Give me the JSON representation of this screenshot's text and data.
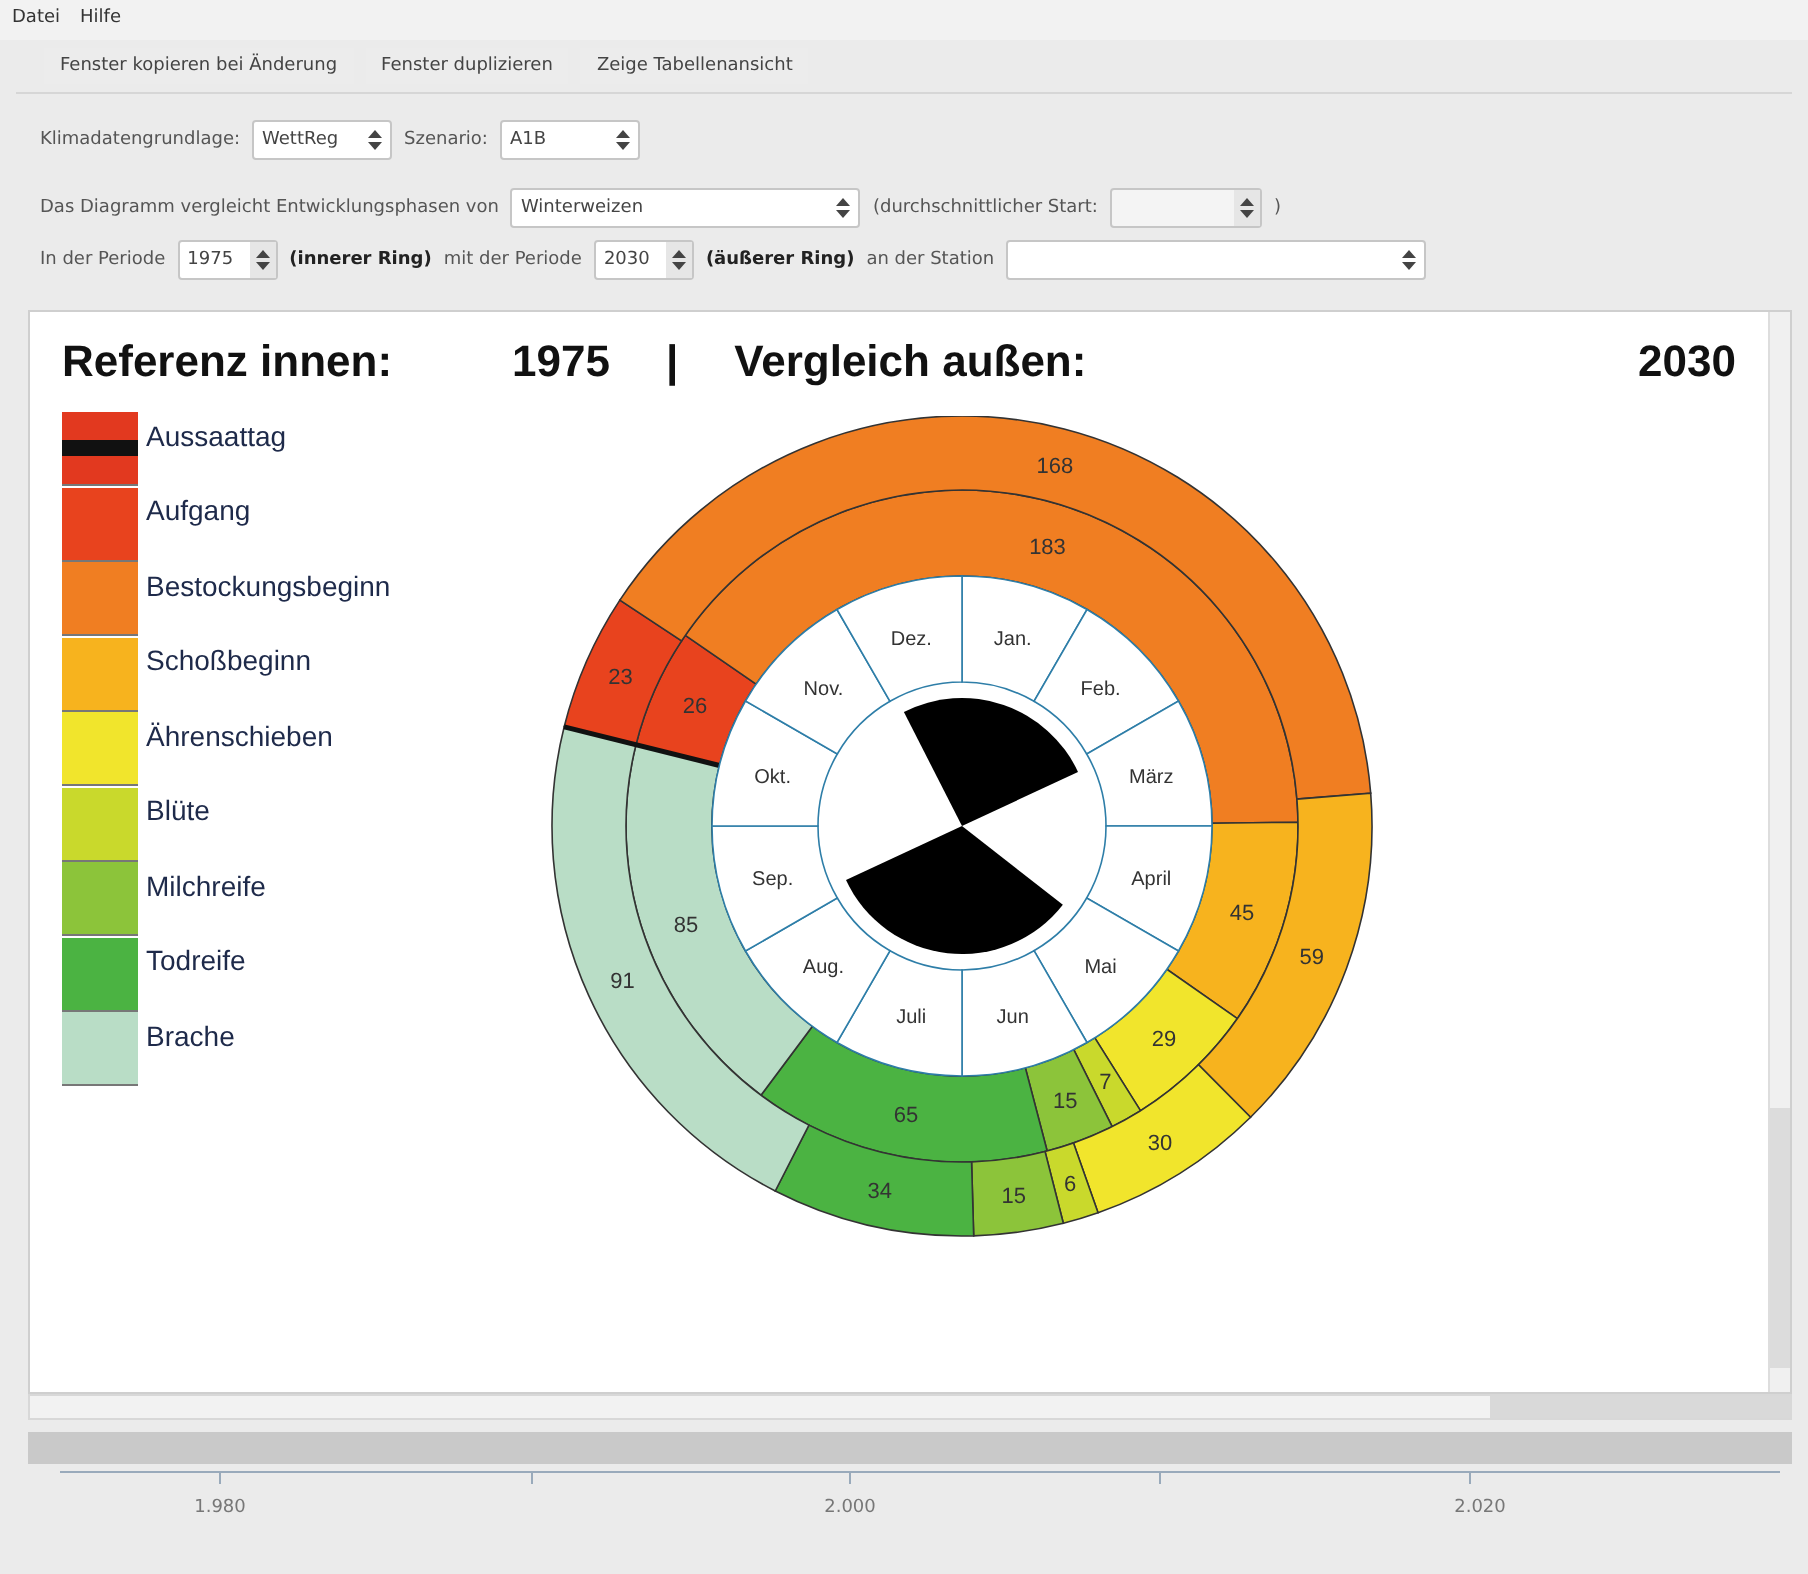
{
  "menu": [
    "Datei",
    "Hilfe"
  ],
  "toolbar": [
    "Fenster kopieren bei Änderung",
    "Fenster duplizieren",
    "Zeige Tabellenansicht"
  ],
  "form_rows": [
    [
      {
        "kind": "label",
        "text": "Klimadatengrundlage:"
      },
      {
        "kind": "select",
        "value": "WettReg"
      },
      {
        "kind": "label",
        "text": "Szenario:"
      },
      {
        "kind": "select",
        "value": "A1B"
      }
    ],
    [
      {
        "kind": "label",
        "text": "Das Diagramm vergleicht Entwicklungsphasen von"
      },
      {
        "kind": "select",
        "value": "Winterweizen"
      },
      {
        "kind": "label",
        "text": "(durchschnittlicher Start:"
      },
      {
        "kind": "spinner",
        "disabled": true
      },
      {
        "kind": "label",
        "text": ")"
      }
    ],
    [
      {
        "kind": "label",
        "text": "In der Periode"
      },
      {
        "kind": "spinner",
        "value": "1975"
      },
      {
        "kind": "bold",
        "text": "(innerer Ring)"
      },
      {
        "kind": "label",
        "text": "mit der Periode"
      },
      {
        "kind": "spinner",
        "value": "2030"
      },
      {
        "kind": "bold",
        "text": "(äußerer Ring)"
      },
      {
        "kind": "label",
        "text": "an der Station"
      },
      {
        "kind": "select"
      }
    ]
  ],
  "chart_header": {
    "inner_label": "Referenz innen:",
    "inner_year": "1975",
    "separator": "|",
    "outer_label": "Vergleich außen:",
    "outer_year": "2030"
  },
  "legend": [
    {
      "label": "Aussaattag",
      "kind": "line",
      "color": "#111111"
    },
    {
      "label": "Aufgang",
      "kind": "fill",
      "color": "#e8431e"
    },
    {
      "label": "Bestockungsbeginn",
      "kind": "fill",
      "color": "#f07e22"
    },
    {
      "label": "Schoßbeginn",
      "kind": "fill",
      "color": "#f7b31e"
    },
    {
      "label": "Ährenschieben",
      "kind": "fill",
      "color": "#f1e52c"
    },
    {
      "label": "Blüte",
      "kind": "fill",
      "color": "#c9d92c"
    },
    {
      "label": "Milchreife",
      "kind": "fill",
      "color": "#8cc43a"
    },
    {
      "label": "Todreife",
      "kind": "fill",
      "color": "#4bb342"
    },
    {
      "label": "Brache",
      "kind": "fill",
      "color": "#b9ddc6"
    }
  ],
  "wheel": {
    "rings": [
      {
        "segments": [
          {
            "label": "26",
            "color": "#e8431e"
          },
          {
            "label": "183",
            "color": "#f07e22"
          },
          {
            "label": "45",
            "color": "#f7b31e"
          },
          {
            "label": "29",
            "color": "#f1e52c"
          },
          {
            "label": "7",
            "color": "#c9d92c"
          },
          {
            "label": "15",
            "color": "#8cc43a"
          },
          {
            "label": "65",
            "color": "#4bb342"
          },
          {
            "label": "85",
            "color": "#b9ddc6"
          }
        ]
      },
      {
        "segments": [
          {
            "label": "23",
            "color": "#e8431e"
          },
          {
            "label": "168",
            "color": "#f07e22"
          },
          {
            "label": "59",
            "color": "#f7b31e"
          },
          {
            "label": "30",
            "color": "#f1e52c"
          },
          {
            "label": "6",
            "color": "#c9d92c"
          },
          {
            "label": "15",
            "color": "#8cc43a"
          },
          {
            "label": "34",
            "color": "#4bb342"
          },
          {
            "label": "91",
            "color": "#b9ddc6"
          }
        ]
      }
    ],
    "months": [
      "Jan.",
      "Feb.",
      "März",
      "April",
      "Mai",
      "Jun",
      "Juli",
      "Aug.",
      "Sep.",
      "Okt.",
      "Nov.",
      "Dez."
    ]
  },
  "timeline": [
    "1.980",
    "2.000",
    "2.020"
  ]
}
